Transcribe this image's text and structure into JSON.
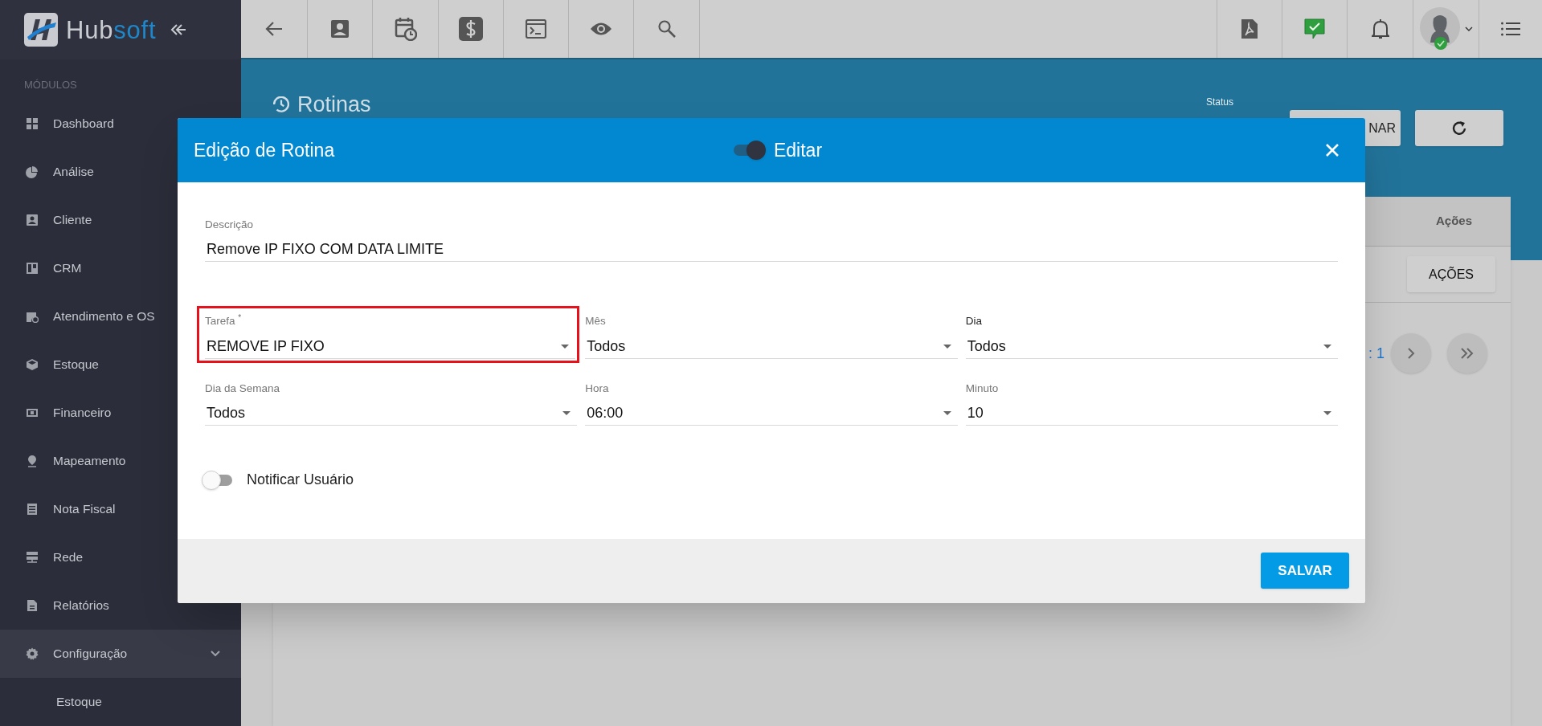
{
  "brand": {
    "name_part_1": "Hub",
    "name_part_2": "soft"
  },
  "sidebar": {
    "section_title": "MÓDULOS",
    "items": [
      {
        "label": "Dashboard",
        "selected": false
      },
      {
        "label": "Análise",
        "selected": false
      },
      {
        "label": "Cliente",
        "selected": false
      },
      {
        "label": "CRM",
        "selected": false
      },
      {
        "label": "Atendimento e OS",
        "selected": false
      },
      {
        "label": "Estoque",
        "selected": false
      },
      {
        "label": "Financeiro",
        "selected": false
      },
      {
        "label": "Mapeamento",
        "selected": false
      },
      {
        "label": "Nota Fiscal",
        "selected": false
      },
      {
        "label": "Rede",
        "selected": false
      },
      {
        "label": "Relatórios",
        "selected": false
      },
      {
        "label": "Configuração",
        "selected": true,
        "expanded": true,
        "children": [
          {
            "label": "Estoque"
          }
        ]
      }
    ]
  },
  "page": {
    "title": "Rotinas",
    "status_label": "Status",
    "filter_button": "NAR",
    "table_header": "Ações",
    "actions_button": "AÇÕES",
    "pagination_text": ": 1"
  },
  "modal": {
    "title": "Edição de Rotina",
    "edit_toggle": {
      "label": "Editar",
      "on": true
    },
    "fields": [
      {
        "label": "Descrição",
        "value": "Remove IP FIXO COM DATA LIMITE",
        "kind": "text",
        "highlighted": false,
        "focused": false
      },
      {
        "label": "Tarefa $^{*}$",
        "value": "REMOVE IP FIXO",
        "kind": "select",
        "highlighted": true,
        "focused": false
      },
      {
        "label": "Mês",
        "value": "Todos",
        "kind": "select",
        "highlighted": false,
        "focused": false
      },
      {
        "label": "Dia",
        "value": "Todos",
        "kind": "select",
        "highlighted": false,
        "focused": true
      },
      {
        "label": "Dia da Semana",
        "value": "Todos",
        "kind": "select",
        "highlighted": false,
        "focused": false
      },
      {
        "label": "Hora",
        "value": "06:00",
        "kind": "select",
        "highlighted": false,
        "focused": false
      },
      {
        "label": "Minuto",
        "value": "10",
        "kind": "select",
        "highlighted": false,
        "focused": false
      }
    ],
    "notify_toggle": {
      "label": "Notificar Usuário",
      "on": false
    },
    "save_button": "SALVAR"
  }
}
